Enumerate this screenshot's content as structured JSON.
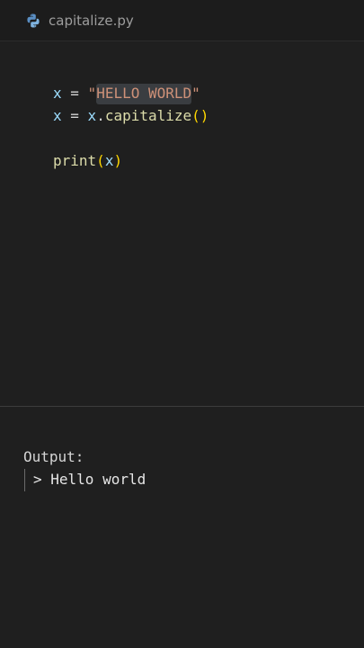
{
  "tab": {
    "filename": "capitalize.py",
    "icon": "python-icon"
  },
  "code": {
    "line1": {
      "var": "x",
      "op": " = ",
      "quote_open": "\"",
      "string": "HELLO WORLD",
      "quote_close": "\""
    },
    "line2": {
      "var": "x",
      "op": " = ",
      "obj": "x",
      "dot": ".",
      "method": "capitalize",
      "parens": "()"
    },
    "line3": {
      "fn": "print",
      "paren_open": "(",
      "arg": "x",
      "paren_close": ")"
    }
  },
  "output": {
    "label": "Output:",
    "prompt": "> ",
    "result": "Hello world"
  },
  "colors": {
    "background": "#1f1f1f",
    "variable": "#9cdcfe",
    "string": "#ce9178",
    "function": "#dcdcaa",
    "bracket": "#ffd700"
  }
}
